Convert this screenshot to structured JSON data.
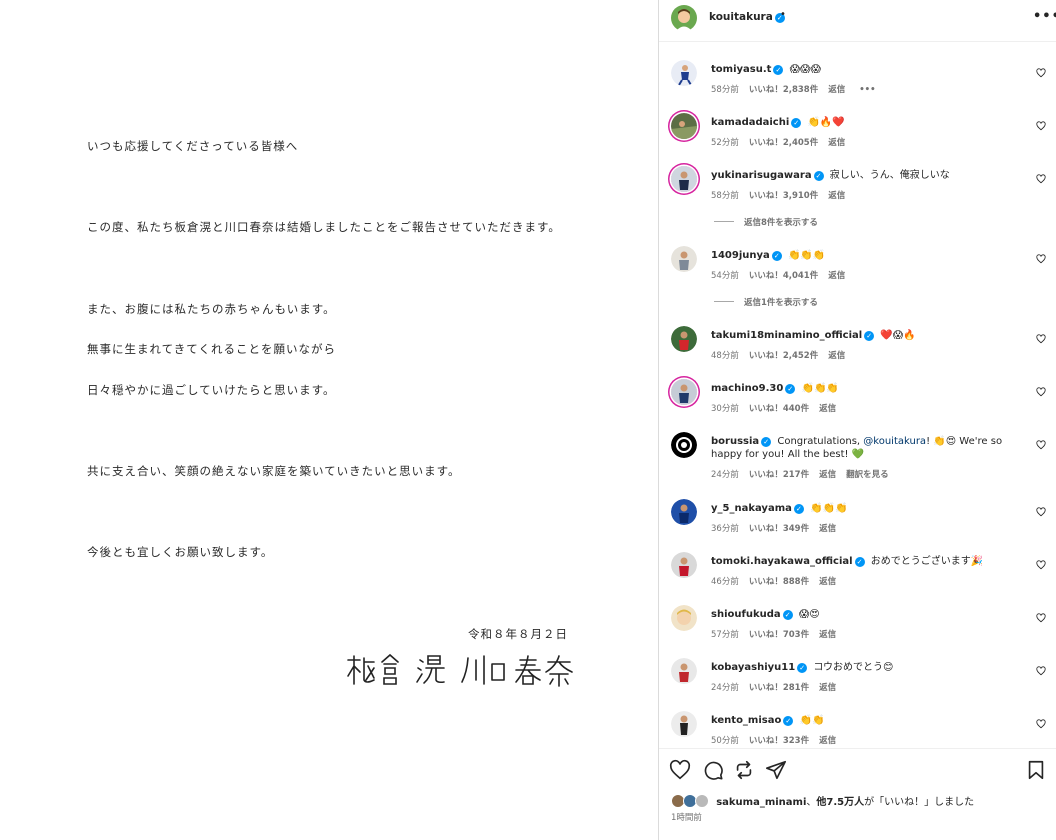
{
  "letter": {
    "lines": [
      "いつも応援してくださっている皆様へ",
      "この度、私たち板倉滉と川口春奈は結婚しましたことをご報告させていただきます。",
      "また、お腹には私たちの赤ちゃんもいます。",
      "無事に生まれてきてくれることを願いながら",
      "日々穏やかに過ごしていけたらと思います。",
      "共に支え合い、笑顔の絶えない家庭を築いていきたいと思います。",
      "今後とも宜しくお願い致します。"
    ],
    "date": "令和８年８月２日",
    "signature": "板倉 滉　川口 春奈"
  },
  "post_header": {
    "username": "kouitakura",
    "dot": "•",
    "more": "•••"
  },
  "comments": [
    {
      "user": "tomiyasu.t",
      "text": "😱😱😱",
      "time": "58分前",
      "likes": "いいね！2,838件",
      "reply": "返信",
      "extra": "•••"
    },
    {
      "user": "kamadadaichi",
      "text": "👏🔥❤️",
      "time": "52分前",
      "likes": "いいね！2,405件",
      "reply": "返信"
    },
    {
      "user": "yukinarisugawara",
      "text": "寂しい、うん、俺寂しいな",
      "time": "58分前",
      "likes": "いいね！3,910件",
      "reply": "返信",
      "view_replies": "返信8件を表示する"
    },
    {
      "user": "1409junya",
      "text": "👏👏👏",
      "time": "54分前",
      "likes": "いいね！4,041件",
      "reply": "返信",
      "view_replies": "返信1件を表示する"
    },
    {
      "user": "takumi18minamino_official",
      "text": "❤️😱🔥",
      "time": "48分前",
      "likes": "いいね！2,452件",
      "reply": "返信"
    },
    {
      "user": "machino9.30",
      "text": "👏👏👏",
      "time": "30分前",
      "likes": "いいね！440件",
      "reply": "返信"
    },
    {
      "user": "borussia",
      "text_before": "Congratulations, ",
      "mention": "@kouitakura",
      "text_after": "! 👏😍 We're so happy for you! All the best! 💚",
      "time": "24分前",
      "likes": "いいね！217件",
      "reply": "返信",
      "translate": "翻訳を見る"
    },
    {
      "user": "y_5_nakayama",
      "text": "👏👏👏",
      "time": "36分前",
      "likes": "いいね！349件",
      "reply": "返信"
    },
    {
      "user": "tomoki.hayakawa_official",
      "text": "おめでとうございます🎉",
      "time": "46分前",
      "likes": "いいね！888件",
      "reply": "返信"
    },
    {
      "user": "shioufukuda",
      "text": "😱😍",
      "time": "57分前",
      "likes": "いいね！703件",
      "reply": "返信"
    },
    {
      "user": "kobayashiyu11",
      "text": "コウおめでとう😊",
      "time": "24分前",
      "likes": "いいね！281件",
      "reply": "返信"
    },
    {
      "user": "kento_misao",
      "text": "👏👏",
      "time": "50分前",
      "likes": "いいね！323件",
      "reply": "返信"
    }
  ],
  "likes_summary": {
    "user": "sakuma_minami",
    "sep": "、",
    "count": "他7.5万人",
    "suffix": "が「いいね！」しました"
  },
  "posted_ago": "1時間前",
  "colors": {
    "verified": "#0095f6",
    "meta": "#737373",
    "text": "#262626",
    "mention": "#00376b"
  }
}
